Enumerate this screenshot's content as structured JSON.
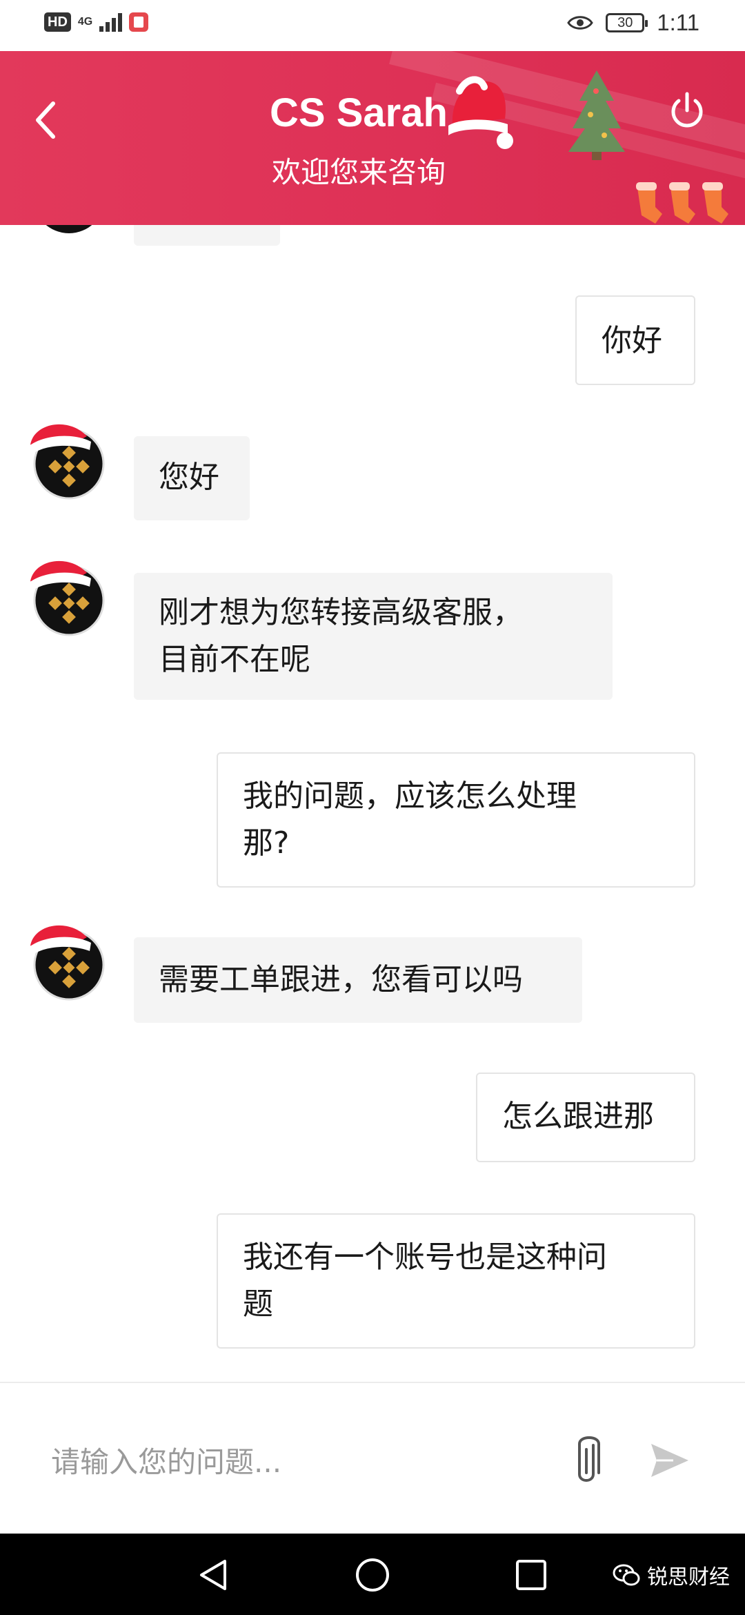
{
  "status_bar": {
    "hd_badge": "HD",
    "network": "4G",
    "battery": "30",
    "time": "1:11"
  },
  "header": {
    "title": "CS Sarah",
    "subtitle": "欢迎您来咨询",
    "background_color": "#e0375a",
    "back_icon": "chevron-left-icon",
    "power_icon": "power-icon"
  },
  "messages": [
    {
      "side": "in",
      "text": "您好"
    },
    {
      "side": "out",
      "text": "你好"
    },
    {
      "side": "in",
      "text": "刚才想为您转接高级客服，\n目前不在呢"
    },
    {
      "side": "out",
      "text": "我的问题，应该怎么处理\n那?"
    },
    {
      "side": "in",
      "text": "需要工单跟进，您看可以吗"
    },
    {
      "side": "out",
      "text": "怎么跟进那"
    },
    {
      "side": "out",
      "text": "我还有一个账号也是这种问\n题"
    }
  ],
  "input": {
    "placeholder": "请输入您的问题...",
    "value": "",
    "attach_icon": "paperclip-icon",
    "send_icon": "send-icon"
  },
  "nav_bar": {
    "back_icon": "triangle-back-icon",
    "home_icon": "circle-home-icon",
    "recents_icon": "square-recents-icon",
    "watermark": "锐思财经"
  },
  "colors": {
    "accent": "#e0375a",
    "incoming_bubble": "#f4f4f4",
    "outgoing_border": "#e4e4e4",
    "avatar_gold": "#d9a13a"
  }
}
